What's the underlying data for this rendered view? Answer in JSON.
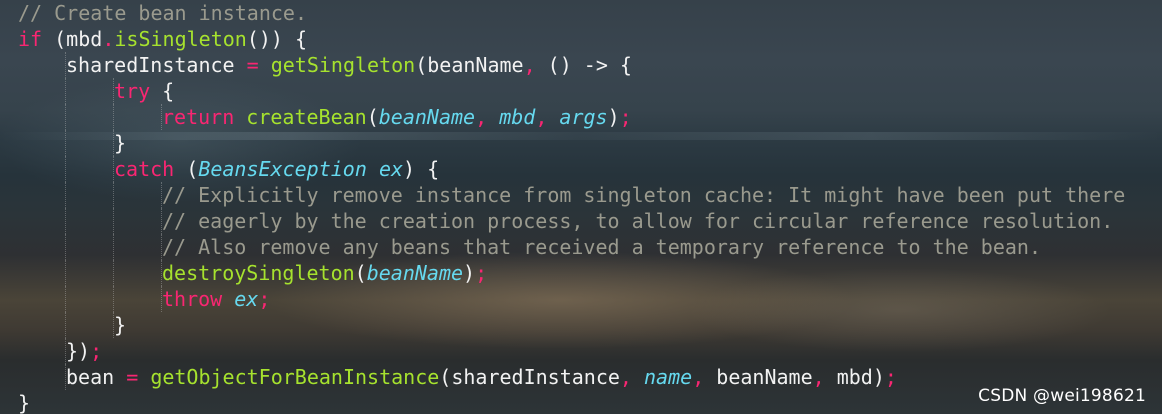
{
  "code_lines": [
    {
      "indent": 0,
      "tokens": [
        {
          "t": "// Create bean instance.",
          "k": "comment"
        }
      ]
    },
    {
      "indent": 0,
      "tokens": [
        {
          "t": "if",
          "k": "keyword"
        },
        {
          "t": " (mbd",
          "k": "plain"
        },
        {
          "t": ".",
          "k": "punct"
        },
        {
          "t": "isSingleton",
          "k": "func"
        },
        {
          "t": "()) {",
          "k": "plain"
        }
      ]
    },
    {
      "indent": 1,
      "tokens": [
        {
          "t": "sharedInstance ",
          "k": "plain"
        },
        {
          "t": "=",
          "k": "punct"
        },
        {
          "t": " ",
          "k": "plain"
        },
        {
          "t": "getSingleton",
          "k": "func"
        },
        {
          "t": "(beanName",
          "k": "plain"
        },
        {
          "t": ",",
          "k": "punct"
        },
        {
          "t": " () -> {",
          "k": "plain"
        }
      ]
    },
    {
      "indent": 2,
      "tokens": [
        {
          "t": "try",
          "k": "keyword"
        },
        {
          "t": " {",
          "k": "plain"
        }
      ]
    },
    {
      "indent": 3,
      "tokens": [
        {
          "t": "return",
          "k": "keyword"
        },
        {
          "t": " ",
          "k": "plain"
        },
        {
          "t": "createBean",
          "k": "func"
        },
        {
          "t": "(",
          "k": "plain"
        },
        {
          "t": "beanName",
          "k": "param"
        },
        {
          "t": ",",
          "k": "punct"
        },
        {
          "t": " ",
          "k": "plain"
        },
        {
          "t": "mbd",
          "k": "param"
        },
        {
          "t": ",",
          "k": "punct"
        },
        {
          "t": " ",
          "k": "plain"
        },
        {
          "t": "args",
          "k": "param"
        },
        {
          "t": ")",
          "k": "plain"
        },
        {
          "t": ";",
          "k": "punct"
        }
      ]
    },
    {
      "indent": 2,
      "tokens": [
        {
          "t": "}",
          "k": "plain"
        }
      ]
    },
    {
      "indent": 2,
      "tokens": [
        {
          "t": "catch",
          "k": "keyword"
        },
        {
          "t": " (",
          "k": "plain"
        },
        {
          "t": "BeansException",
          "k": "type"
        },
        {
          "t": " ",
          "k": "plain"
        },
        {
          "t": "ex",
          "k": "param"
        },
        {
          "t": ") {",
          "k": "plain"
        }
      ]
    },
    {
      "indent": 3,
      "tokens": [
        {
          "t": "// Explicitly remove instance from singleton cache: It might have been put there",
          "k": "comment"
        }
      ]
    },
    {
      "indent": 3,
      "tokens": [
        {
          "t": "// eagerly by the creation process, to allow for circular reference resolution.",
          "k": "comment"
        }
      ]
    },
    {
      "indent": 3,
      "tokens": [
        {
          "t": "// Also remove any beans that received a temporary reference to the bean.",
          "k": "comment"
        }
      ]
    },
    {
      "indent": 3,
      "tokens": [
        {
          "t": "destroySingleton",
          "k": "func"
        },
        {
          "t": "(",
          "k": "plain"
        },
        {
          "t": "beanName",
          "k": "param"
        },
        {
          "t": ")",
          "k": "plain"
        },
        {
          "t": ";",
          "k": "punct"
        }
      ]
    },
    {
      "indent": 3,
      "tokens": [
        {
          "t": "throw",
          "k": "keyword"
        },
        {
          "t": " ",
          "k": "plain"
        },
        {
          "t": "ex",
          "k": "param"
        },
        {
          "t": ";",
          "k": "punct"
        }
      ]
    },
    {
      "indent": 2,
      "tokens": [
        {
          "t": "}",
          "k": "plain"
        }
      ]
    },
    {
      "indent": 1,
      "tokens": [
        {
          "t": "})",
          "k": "plain"
        },
        {
          "t": ";",
          "k": "punct"
        }
      ]
    },
    {
      "indent": 1,
      "tokens": [
        {
          "t": "bean ",
          "k": "plain"
        },
        {
          "t": "=",
          "k": "punct"
        },
        {
          "t": " ",
          "k": "plain"
        },
        {
          "t": "getObjectForBeanInstance",
          "k": "func"
        },
        {
          "t": "(sharedInstance",
          "k": "plain"
        },
        {
          "t": ",",
          "k": "punct"
        },
        {
          "t": " ",
          "k": "plain"
        },
        {
          "t": "name",
          "k": "param"
        },
        {
          "t": ",",
          "k": "punct"
        },
        {
          "t": " beanName",
          "k": "plain"
        },
        {
          "t": ",",
          "k": "punct"
        },
        {
          "t": " mbd)",
          "k": "plain"
        },
        {
          "t": ";",
          "k": "punct"
        }
      ]
    },
    {
      "indent": 0,
      "tokens": [
        {
          "t": "}",
          "k": "plain"
        }
      ]
    }
  ],
  "watermark": "CSDN @wei198621",
  "colors": {
    "keyword": "#f92672",
    "function": "#a6e22e",
    "parameter": "#66d9ef",
    "comment": "#9a9a8e",
    "plain": "#f2f2f2"
  }
}
